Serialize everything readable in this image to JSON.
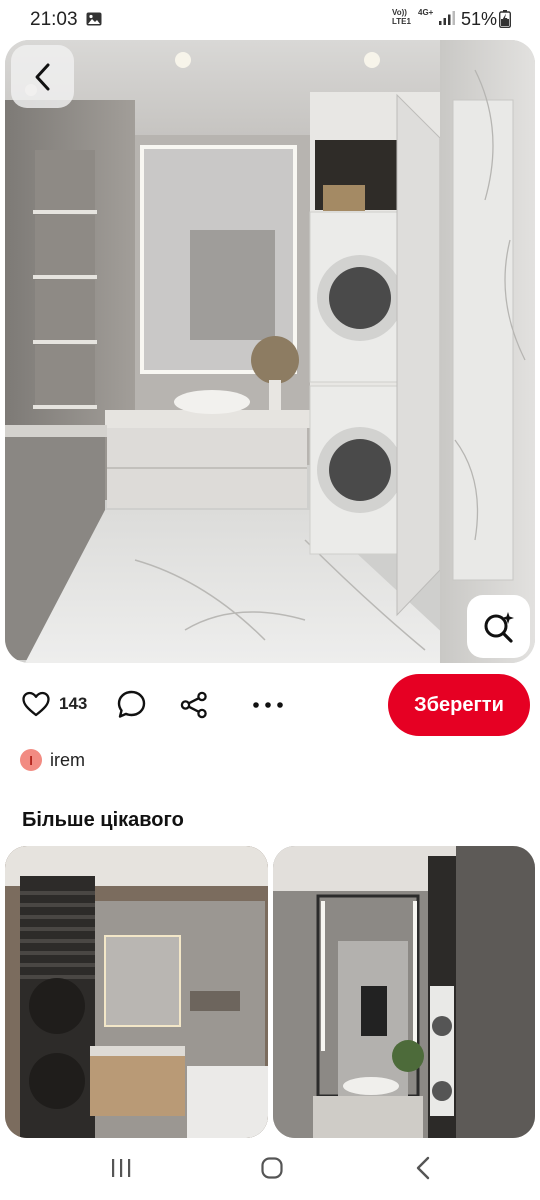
{
  "status_bar": {
    "time": "21:03",
    "network_line1": "Vo))",
    "network_line2": "LTE1",
    "network_type": "4G+",
    "battery": "51%",
    "icons": [
      "image-notification-icon",
      "signal-icon",
      "battery-icon"
    ]
  },
  "pin": {
    "like_count": "143",
    "save_label": "Зберегти",
    "author_initial": "I",
    "author_name": "irem"
  },
  "more_section": {
    "title": "Більше цікавого"
  },
  "colors": {
    "save_button": "#e60023",
    "avatar_bg": "#f28b82",
    "avatar_text": "#b3261e"
  }
}
